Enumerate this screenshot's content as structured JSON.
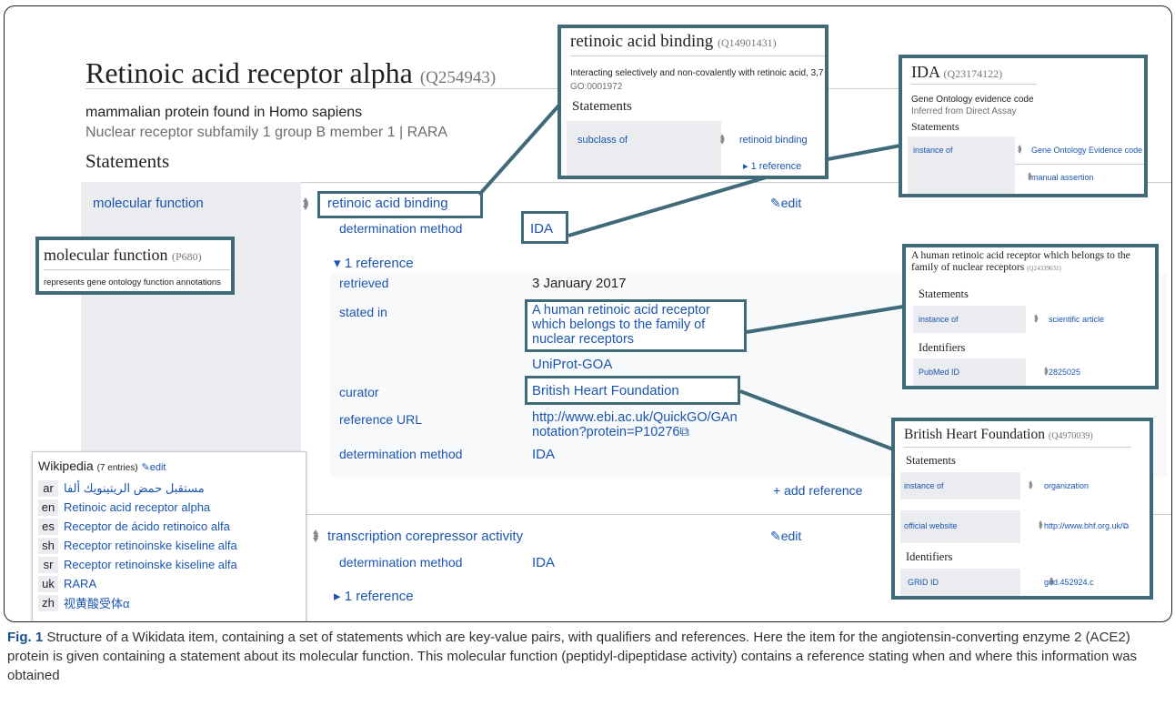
{
  "item": {
    "title": "Retinoic acid receptor alpha",
    "qid": "(Q254943)",
    "description": "mammalian protein found in Homo sapiens",
    "aliases": "Nuclear receptor subfamily 1 group B member 1 | RARA",
    "statements_heading": "Statements"
  },
  "statements": [
    {
      "property": "molecular function",
      "value": "retinoic acid binding",
      "edit": "edit",
      "qualifier_label": "determination method",
      "qualifier_value": "IDA",
      "references_toggle": "1 reference",
      "reference": {
        "retrieved_label": "retrieved",
        "retrieved_value": "3 January 2017",
        "stated_in_label": "stated in",
        "stated_in_value1": "A human retinoic acid receptor which belongs to the family of nuclear receptors",
        "stated_in_value2": "UniProt-GOA",
        "curator_label": "curator",
        "curator_value": "British Heart Foundation",
        "url_label": "reference URL",
        "url_value": "http://www.ebi.ac.uk/QuickGO/GAnnotation?protein=P10276",
        "method_label": "determination method",
        "method_value": "IDA"
      },
      "add_reference": "+ add reference"
    },
    {
      "value": "transcription corepressor activity",
      "edit": "edit",
      "qualifier_label": "determination method",
      "qualifier_value": "IDA",
      "references_toggle": "1 reference"
    }
  ],
  "cards": {
    "retinoic": {
      "title": "retinoic acid binding",
      "qid": "(Q14901431)",
      "description": "Interacting selectively and non-covalently with retinoic acid, 3,7",
      "go": "GO:0001972",
      "statements": "Statements",
      "prop": "subclass of",
      "value": "retinoid binding",
      "refs": "1 reference"
    },
    "ida": {
      "title": "IDA",
      "qid": "(Q23174122)",
      "description": "Gene Ontology evidence code",
      "alias": "Inferred from Direct Assay",
      "statements": "Statements",
      "prop": "instance of",
      "value1": "Gene Ontology Evidence code",
      "value2": "manual assertion"
    },
    "molecular": {
      "title": "molecular function",
      "pid": "(P680)",
      "description": "represents gene ontology function annotations"
    },
    "human": {
      "title": "A human retinoic acid receptor which belongs to the family of nuclear receptors",
      "qid": "(Q24339631)",
      "statements": "Statements",
      "prop": "instance of",
      "value": "scientific article",
      "identifiers": "Identifiers",
      "id_prop": "PubMed ID",
      "id_value": "2825025"
    },
    "bhf": {
      "title": "British Heart Foundation",
      "qid": "(Q4970039)",
      "statements": "Statements",
      "prop1": "instance of",
      "value1": "organization",
      "prop2": "official website",
      "value2": "http://www.bhf.org.uk/",
      "identifiers": "Identifiers",
      "id_prop": "GRID ID",
      "id_value": "grid.452924.c"
    }
  },
  "wikipedia": {
    "title": "Wikipedia",
    "count": "(7 entries)",
    "edit": "edit",
    "entries": [
      {
        "code": "ar",
        "label": "مستقبل حمض الريتينويك ألفا"
      },
      {
        "code": "en",
        "label": "Retinoic acid receptor alpha"
      },
      {
        "code": "es",
        "label": "Receptor de ácido retinoico alfa"
      },
      {
        "code": "sh",
        "label": "Receptor retinoinske kiseline alfa"
      },
      {
        "code": "sr",
        "label": "Receptor retinoinske kiseline alfa"
      },
      {
        "code": "uk",
        "label": "RARA"
      },
      {
        "code": "zh",
        "label": "视黄酸受体α"
      }
    ]
  },
  "caption": {
    "label": "Fig. 1",
    "text": " Structure of a Wikidata item, containing a set of statements which are key-value pairs, with qualifiers and references. Here the item for the angiotensin-converting enzyme 2 (ACE2) protein is given containing a statement about its molecular function. This molecular function (peptidyl-dipeptidase activity) contains a reference stating when and where this information was obtained"
  },
  "colors": {
    "accent": "#3f6b78",
    "link": "#1a55b0",
    "panel": "#eaecf0"
  }
}
